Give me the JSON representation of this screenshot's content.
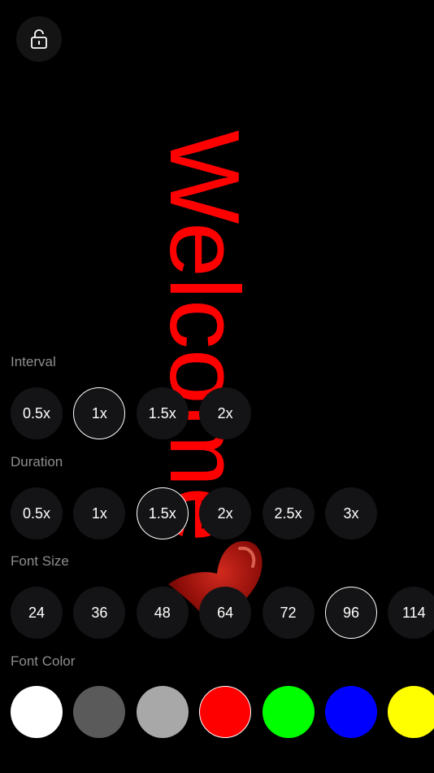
{
  "lock": {
    "icon": "unlock-icon"
  },
  "banner": {
    "text": "Welcome",
    "color": "#ff0000",
    "heart_icon": "heart-icon"
  },
  "interval": {
    "label": "Interval",
    "options": [
      "0.5x",
      "1x",
      "1.5x",
      "2x"
    ],
    "selected": "1x"
  },
  "duration": {
    "label": "Duration",
    "options": [
      "0.5x",
      "1x",
      "1.5x",
      "2x",
      "2.5x",
      "3x"
    ],
    "selected": "1.5x"
  },
  "font_size": {
    "label": "Font Size",
    "options": [
      "24",
      "36",
      "48",
      "64",
      "72",
      "96",
      "114"
    ],
    "selected": "96"
  },
  "font_color": {
    "label": "Font Color",
    "swatches": [
      "#ffffff",
      "#5a5a5a",
      "#a8a8a8",
      "#ff0000",
      "#00ff00",
      "#0000ff",
      "#ffff00"
    ],
    "selected": "#ff0000"
  }
}
